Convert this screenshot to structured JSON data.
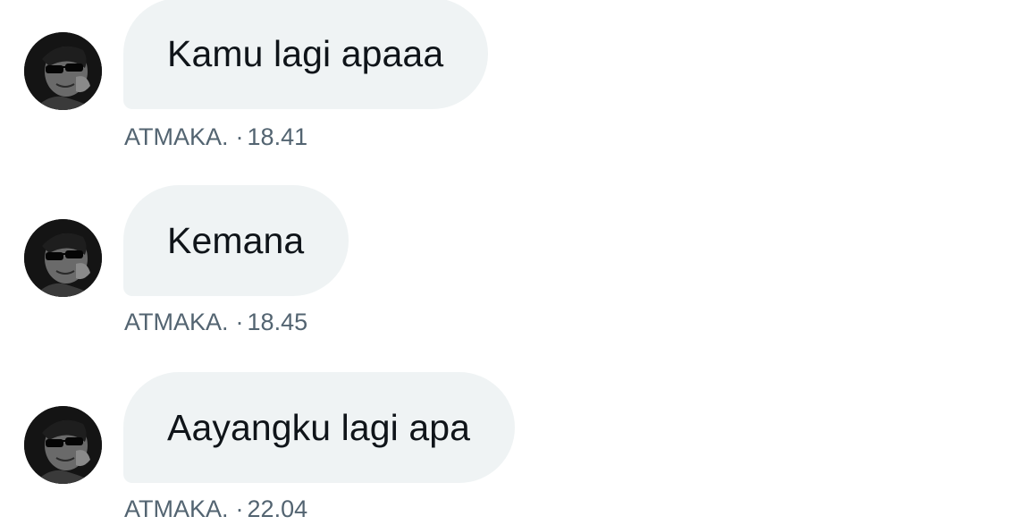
{
  "messages": [
    {
      "text": "Kamu lagi apaaa",
      "sender": "ATMAKA.",
      "time": "18.41"
    },
    {
      "text": "Kemana",
      "sender": "ATMAKA.",
      "time": "18.45"
    },
    {
      "text": "Aayangku lagi apa",
      "sender": "ATMAKA.",
      "time": "22.04"
    }
  ],
  "meta_separator": "·",
  "colors": {
    "bubble_bg": "#eff3f4",
    "text": "#0f1419",
    "meta_text": "#536471"
  },
  "icons": {
    "avatar": "user-avatar-photo"
  }
}
